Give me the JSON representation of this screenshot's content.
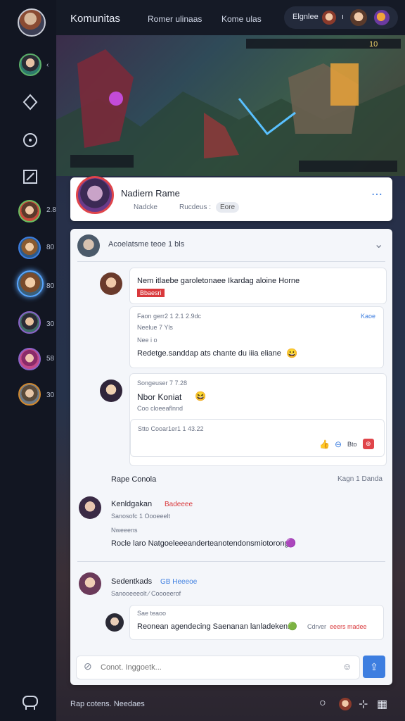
{
  "app": {
    "title": "Komunitas",
    "tabs": [
      "Romer ulinaas",
      "Kome ulas"
    ]
  },
  "top_right": {
    "label": "Elgnlee",
    "divider": "ı"
  },
  "hero": {
    "hud_value": "10"
  },
  "profile": {
    "name": "Nadiern Rame",
    "meta1": "Nadcke",
    "meta2": "Rucdeus :",
    "tag": "Eore"
  },
  "thread": {
    "header": "Acoelatsme teoe 1 bls",
    "post1": {
      "text": "Nem itlaebe garoletonaee Ikardag aloine Horne",
      "badge": "Bbaesri"
    },
    "quote1": {
      "line1": "Faon gerr2 1 2.1 2.9dc",
      "right": "Kaoe",
      "line2": "Neelue 7 Yls",
      "line3": "Nee i o",
      "line4": "Redetge.sanddap ats chante du iiia eliane"
    },
    "post2": {
      "meta": "Songeuser 7 7.28",
      "title": "Nbor Koniat",
      "sub": "Coo cloeeaflnnd"
    },
    "quote2": {
      "line": "Stto Cooar1er1 1 43.22",
      "count": "Bto"
    },
    "section": {
      "left": "Rape Conola",
      "right": "Kagn 1 Danda"
    },
    "c1": {
      "name": "Kenldgakan",
      "badge": "Badeeee",
      "sub": "Sanosofc 1 Oooeeelt",
      "role": "Nweeens",
      "text": "Rocle laro Natgoeleeeanderteanotendonsmiotorong"
    },
    "c2": {
      "name": "Sedentkads",
      "badge": "GB Heeeoe",
      "sub": "Sanooeeeolt ⁄ Coooeerof"
    },
    "q3": {
      "label": "Sae teaoo",
      "text": "Reonean agendecing Saenanan lanladeken.",
      "trail": "Cdrver",
      "trail2": "eeers madee"
    },
    "input_placeholder": "Conot. Inggoetk..."
  },
  "footer": {
    "label": "Rap cotens. Needaes"
  },
  "colors": {
    "accent": "#3d7ee0",
    "red": "#d9393c",
    "dark": "#121622"
  }
}
